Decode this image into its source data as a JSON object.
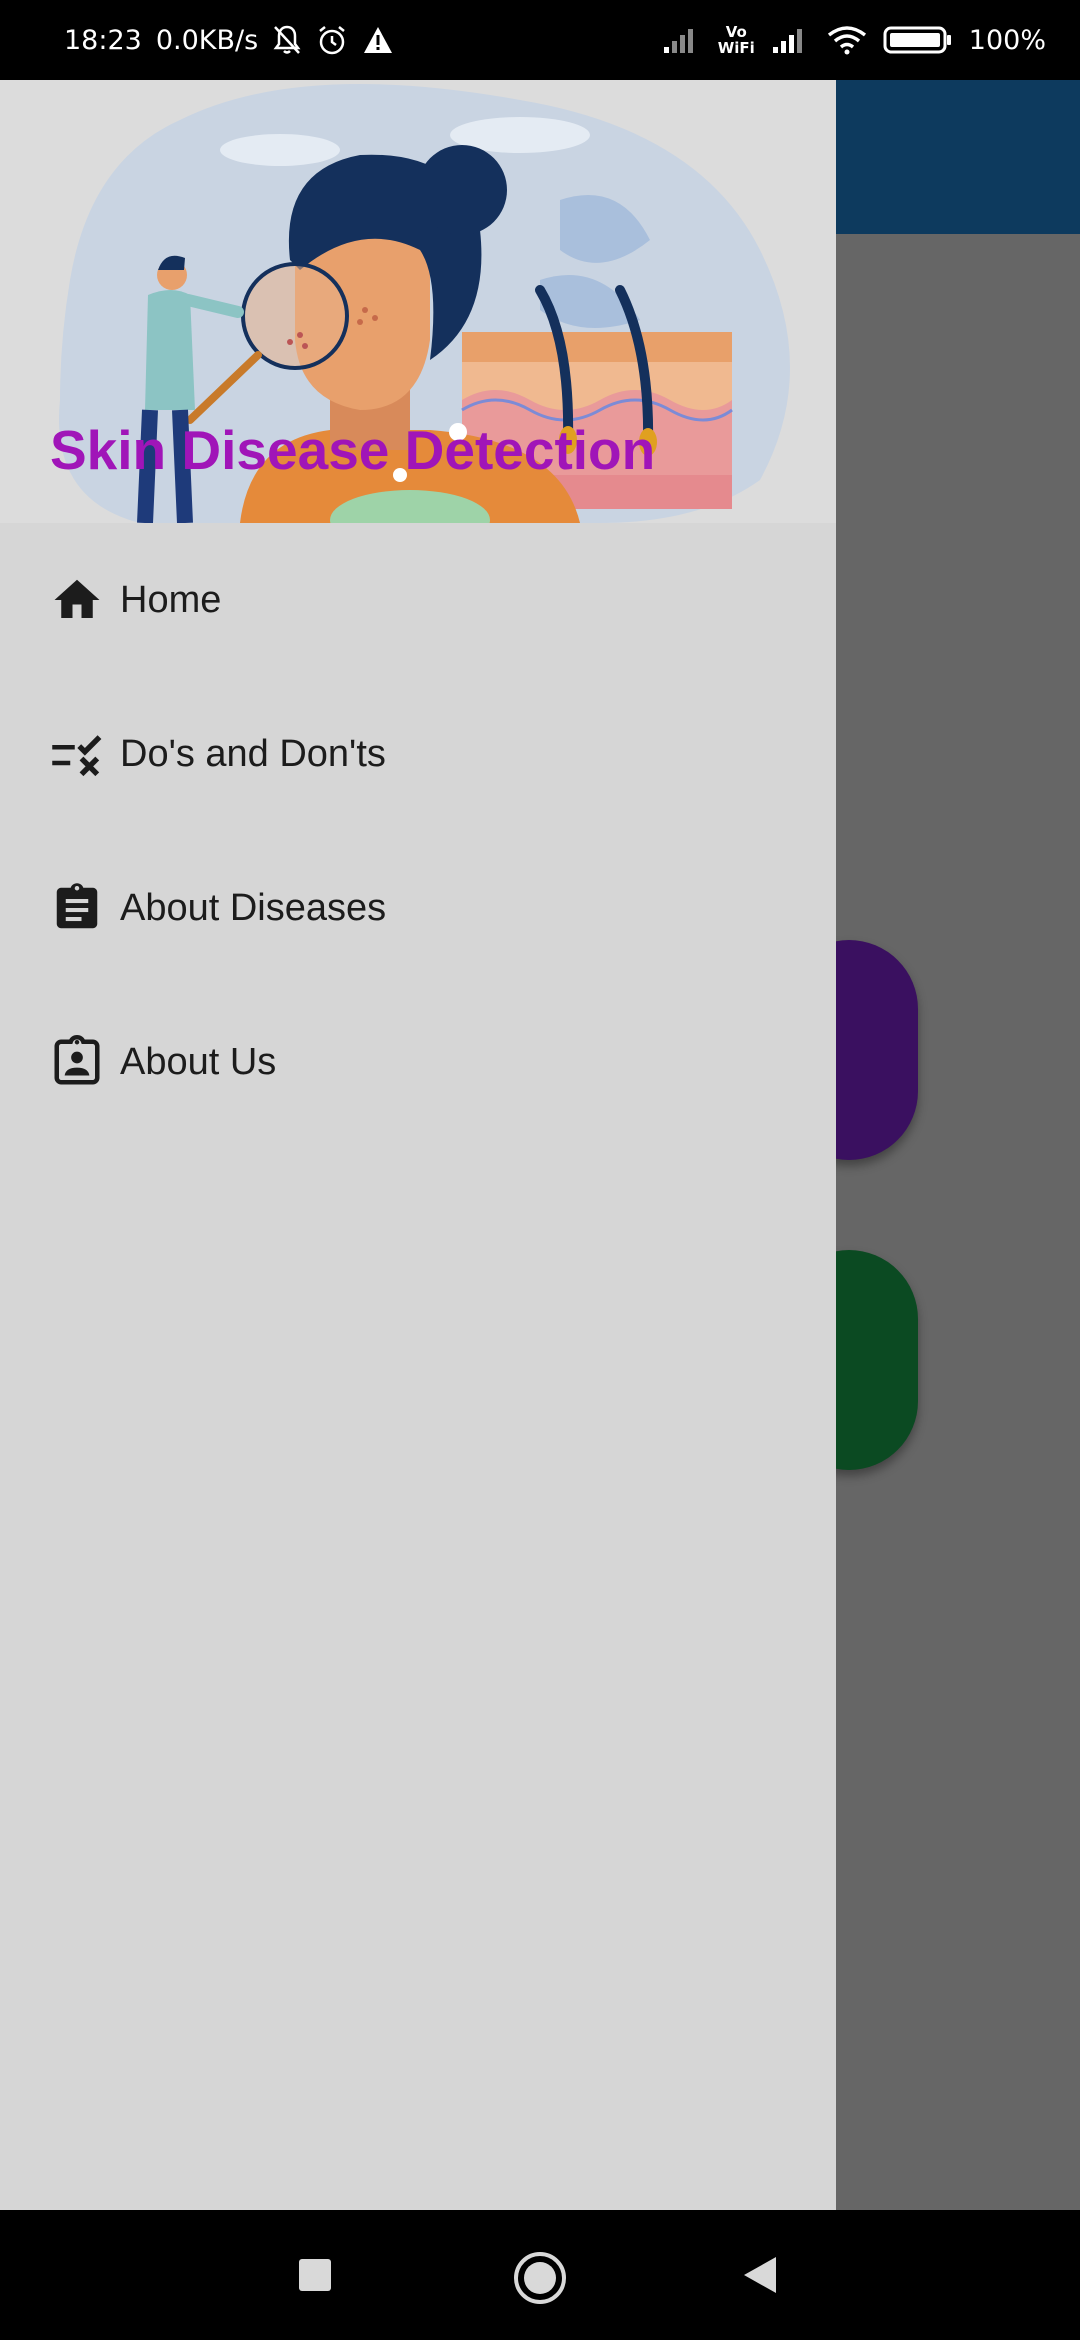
{
  "status_bar": {
    "time": "18:23",
    "speed": "0.0KB/s",
    "vowifi_top": "Vo",
    "vowifi_bottom": "WiFi",
    "battery": "100%",
    "icons": [
      "mute-bell-icon",
      "alarm-icon",
      "warning-icon",
      "signal-icon",
      "vowifi-icon",
      "signal-icon",
      "wifi-icon",
      "battery-icon"
    ]
  },
  "drawer": {
    "header_title": "Skin Disease Detection",
    "items": [
      {
        "label": "Home",
        "icon": "home-icon"
      },
      {
        "label": "Do's and Don'ts",
        "icon": "checklist-icon"
      },
      {
        "label": "About Diseases",
        "icon": "clipboard-icon"
      },
      {
        "label": "About Us",
        "icon": "contact-card-icon"
      }
    ]
  },
  "nav_bar": {
    "icons": [
      "recents-square-icon",
      "home-circle-icon",
      "back-triangle-icon"
    ]
  },
  "colors": {
    "title": "#a015b8",
    "app_bar": "#0d3a5e",
    "purple_button": "#3a1060",
    "green_button": "#0b4a22"
  }
}
